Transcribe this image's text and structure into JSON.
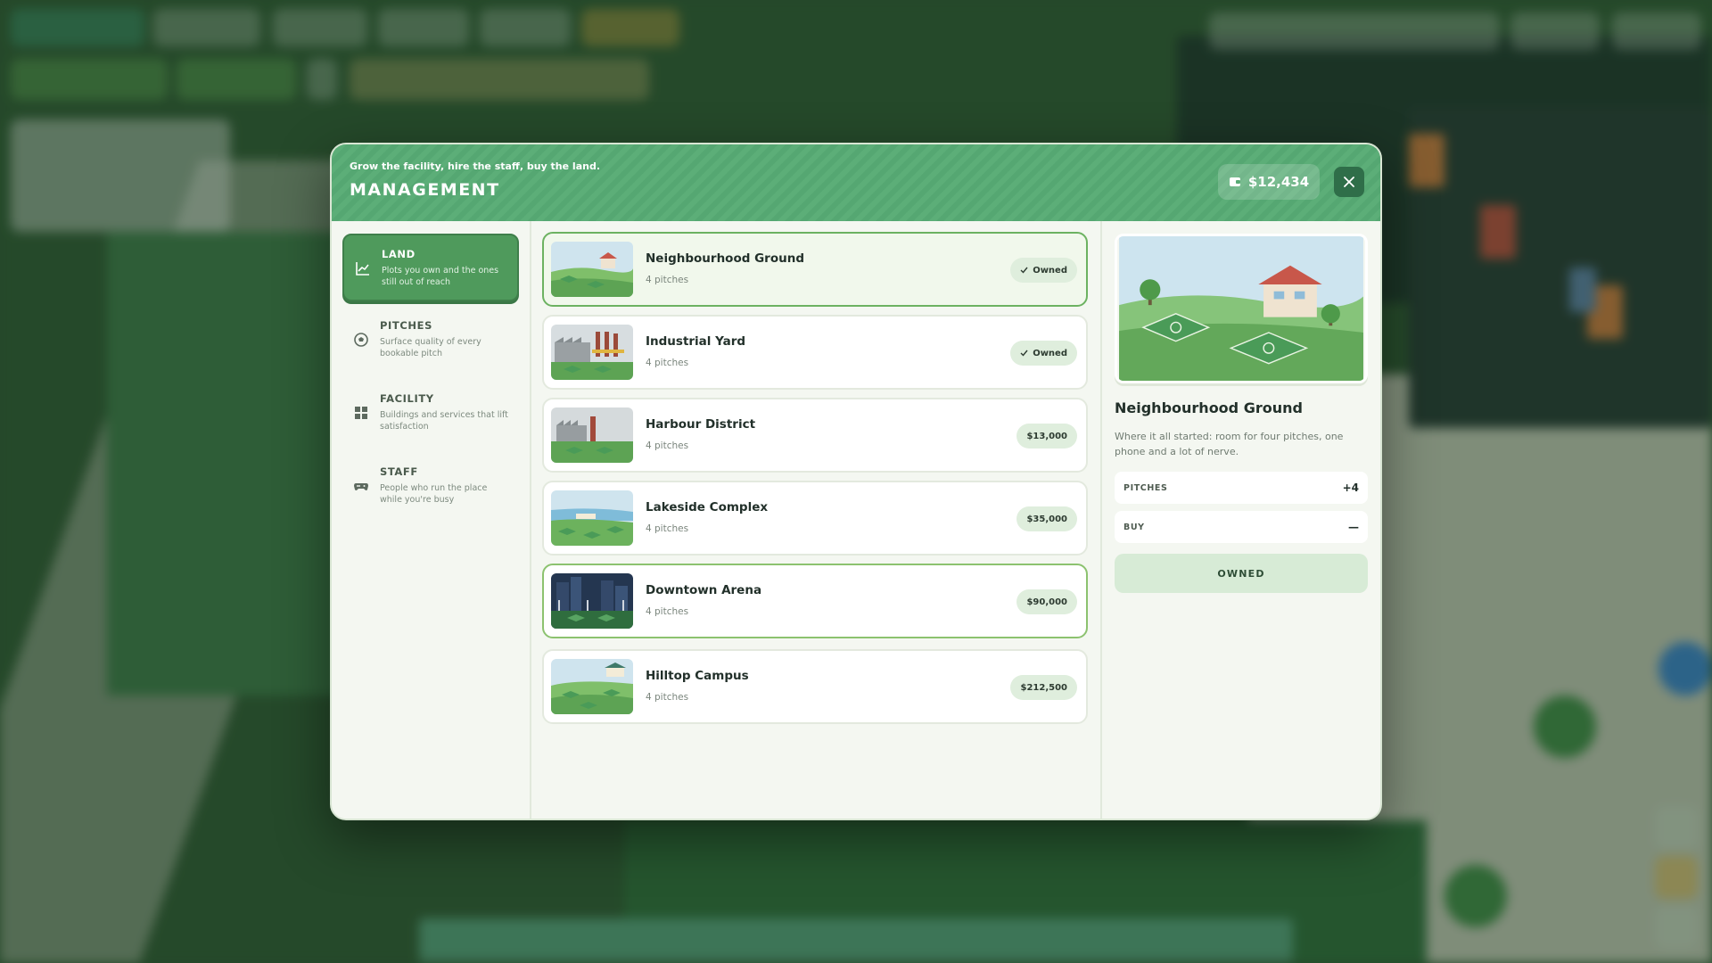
{
  "header": {
    "subtitle": "Grow the facility, hire the staff, buy the land.",
    "title": "MANAGEMENT",
    "money": "$12,434"
  },
  "sidebar": {
    "items": [
      {
        "label": "LAND",
        "desc": "Plots you own and the ones still out of reach",
        "icon": "chart-line-icon",
        "active": true
      },
      {
        "label": "PITCHES",
        "desc": "Surface quality of every bookable pitch",
        "icon": "soccer-ball-icon",
        "active": false
      },
      {
        "label": "FACILITY",
        "desc": "Buildings and services that lift satisfaction",
        "icon": "grid-icon",
        "active": false
      },
      {
        "label": "STAFF",
        "desc": "People who run the place while you're busy",
        "icon": "gamepad-icon",
        "active": false
      }
    ]
  },
  "lands": [
    {
      "name": "Neighbourhood Ground",
      "sub": "4 pitches",
      "status": "Owned"
    },
    {
      "name": "Industrial Yard",
      "sub": "4 pitches",
      "status": "Owned"
    },
    {
      "name": "Harbour District",
      "sub": "4 pitches",
      "status": "$13,000"
    },
    {
      "name": "Lakeside Complex",
      "sub": "4 pitches",
      "status": "$35,000"
    },
    {
      "name": "Downtown Arena",
      "sub": "4 pitches",
      "status": "$90,000"
    },
    {
      "name": "Hilltop Campus",
      "sub": "4 pitches",
      "status": "$212,500"
    }
  ],
  "detail": {
    "name": "Neighbourhood Ground",
    "desc": "Where it all started: room for four pitches, one phone and a lot of nerve.",
    "stats": [
      {
        "key": "PITCHES",
        "value": "+4"
      },
      {
        "key": "BUY",
        "value": "—"
      }
    ],
    "button": "OWNED"
  },
  "colors": {
    "accent": "#4f9a5c",
    "header": "#58aa74",
    "badge": "#dfeedd"
  }
}
